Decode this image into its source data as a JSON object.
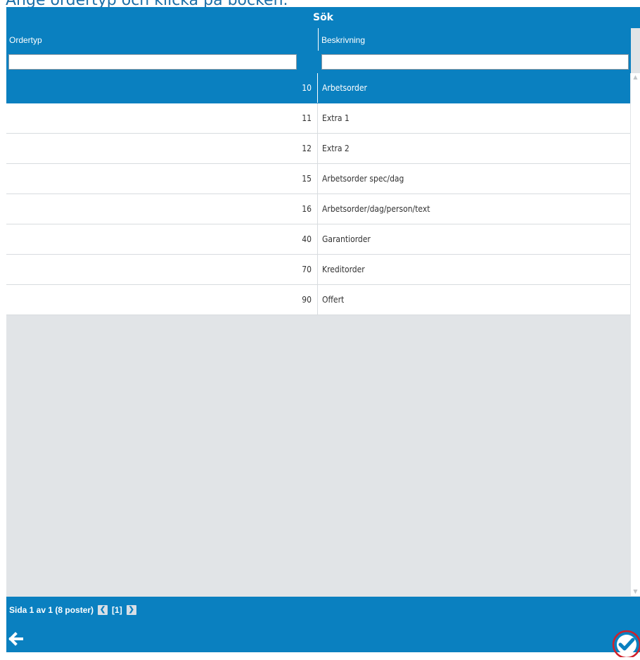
{
  "instruction": "Ange ordertyp och klicka på bocken.",
  "title": "Sök",
  "columns": {
    "ordertyp": "Ordertyp",
    "beskrivning": "Beskrivning"
  },
  "filters": {
    "ordertyp": "",
    "beskrivning": ""
  },
  "rows": [
    {
      "code": "10",
      "desc": "Arbetsorder",
      "selected": true
    },
    {
      "code": "11",
      "desc": "Extra 1"
    },
    {
      "code": "12",
      "desc": "Extra 2"
    },
    {
      "code": "15",
      "desc": "Arbetsorder spec/dag"
    },
    {
      "code": "16",
      "desc": "Arbetsorder/dag/person/text"
    },
    {
      "code": "40",
      "desc": "Garantiorder"
    },
    {
      "code": "70",
      "desc": "Kreditorder"
    },
    {
      "code": "90",
      "desc": "Offert"
    }
  ],
  "pager": {
    "summary": "Sida 1 av 1 (8 poster)",
    "current": "[1]"
  },
  "icons": {
    "back": "arrow-left-icon",
    "confirm": "checkmark-icon",
    "prev": "chevron-left-icon",
    "next": "chevron-right-icon"
  },
  "colors": {
    "accent": "#0a80c0",
    "empty_area": "#e1e4e7",
    "highlight_ring": "#d0202a"
  }
}
